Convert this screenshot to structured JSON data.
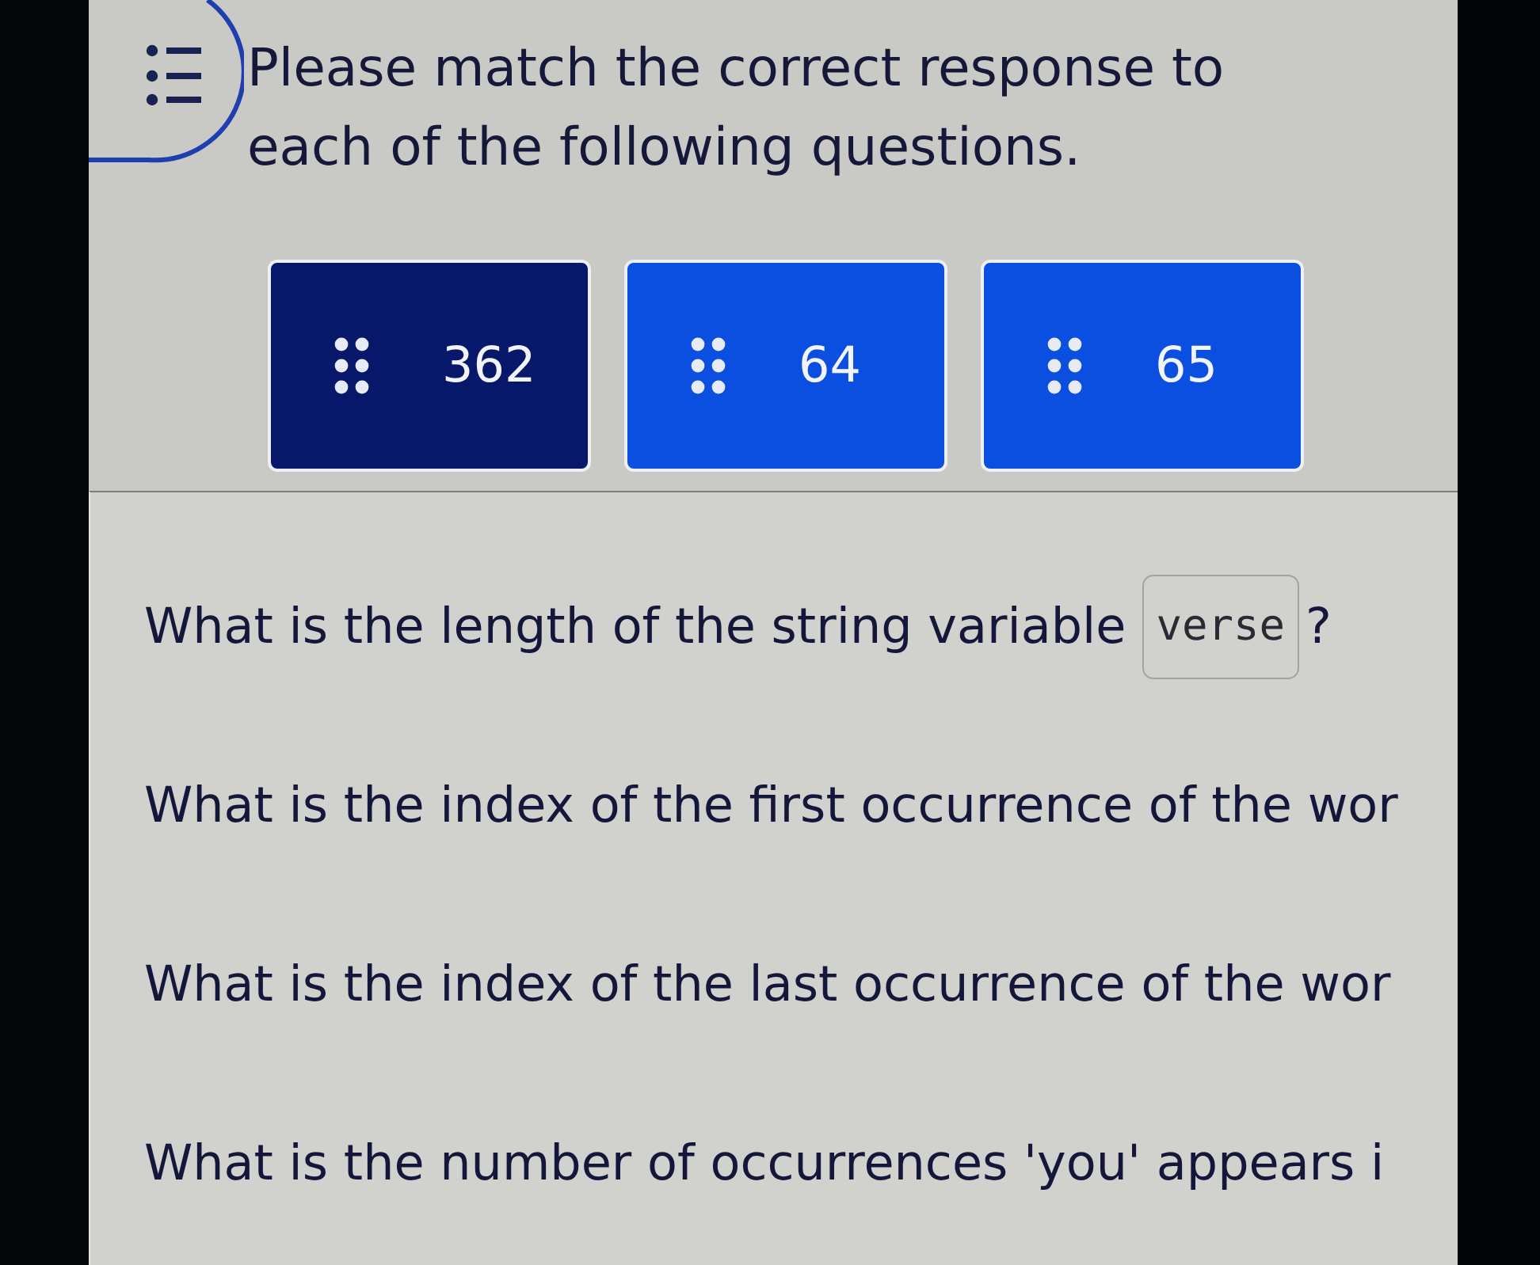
{
  "instruction": {
    "text": "Please match the correct response to each of the following questions."
  },
  "answers": [
    {
      "label": "362",
      "selected": true
    },
    {
      "label": "64",
      "selected": false
    },
    {
      "label": "65",
      "selected": false
    }
  ],
  "questions": [
    {
      "kind": "code",
      "text": "What is the length of the string variable",
      "code": "verse",
      "suffix": "?"
    },
    {
      "kind": "plain",
      "text": "What is the index of the first occurrence of the wor"
    },
    {
      "kind": "plain",
      "text": "What is the index of the last occurrence of the wor"
    },
    {
      "kind": "plain",
      "text": "What is the number of occurrences 'you' appears i"
    }
  ]
}
